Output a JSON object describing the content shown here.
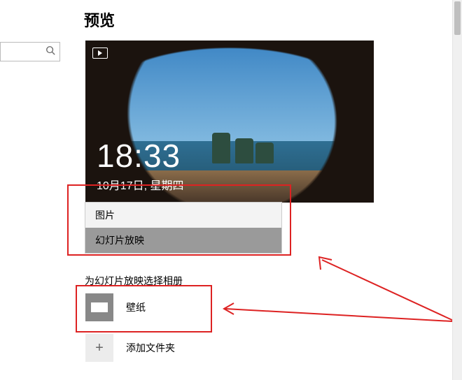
{
  "header": {
    "title": "预览"
  },
  "search": {
    "placeholder": ""
  },
  "lockscreen": {
    "time": "18:33",
    "date": "10月17日, 星期四"
  },
  "background_dropdown": {
    "options": [
      {
        "label": "图片"
      },
      {
        "label": "幻灯片放映"
      }
    ]
  },
  "albums": {
    "heading": "为幻灯片放映选择相册",
    "items": [
      {
        "label": "壁纸"
      }
    ],
    "add_label": "添加文件夹"
  }
}
